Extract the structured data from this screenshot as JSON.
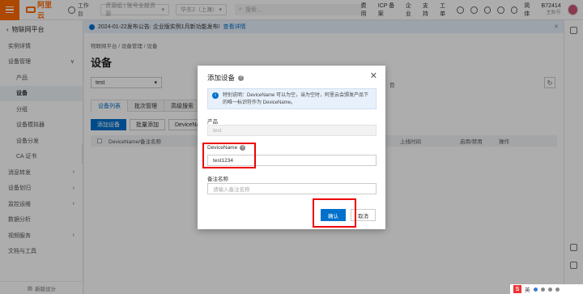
{
  "topbar": {
    "logo_text": "阿里云",
    "workbench": "工作台",
    "account_select": "资源组 | 账号全部资源",
    "region_select": "华东2（上海）",
    "search_placeholder": "搜索...",
    "links": [
      "费用",
      "ICP 备案",
      "企业",
      "支持",
      "工单"
    ],
    "lang": "简体",
    "user_id": "B72414",
    "user_sub": "主账号"
  },
  "sidebar": {
    "title": "物联网平台",
    "items": [
      {
        "label": "实例详情",
        "kind": "top"
      },
      {
        "label": "设备管理",
        "kind": "group",
        "arrow": "∨"
      },
      {
        "label": "产品",
        "kind": "sub"
      },
      {
        "label": "设备",
        "kind": "sub",
        "active": true
      },
      {
        "label": "分组",
        "kind": "sub"
      },
      {
        "label": "设备模拟器",
        "kind": "sub"
      },
      {
        "label": "设备分发",
        "kind": "sub"
      },
      {
        "label": "CA 证书",
        "kind": "sub"
      },
      {
        "label": "消息转发",
        "kind": "group",
        "arrow": "›"
      },
      {
        "label": "设备划归",
        "kind": "group",
        "arrow": "›"
      },
      {
        "label": "监控运维",
        "kind": "group",
        "arrow": "›"
      },
      {
        "label": "数据分析",
        "kind": "top"
      },
      {
        "label": "视频服务",
        "kind": "group",
        "arrow": "›"
      },
      {
        "label": "文档与工具",
        "kind": "top"
      }
    ],
    "collapse_label": "新版设计"
  },
  "notice": {
    "text": "2024-01-22发布公告: 企业版实例1月新功能发布!",
    "link": "查看详情"
  },
  "main": {
    "breadcrumb": "物联网平台 / 设备管理 / 设备",
    "title": "设备",
    "product_select": "test",
    "right_label": "目",
    "tabs": [
      "设备列表",
      "批次管理",
      "高级搜索"
    ],
    "buttons": {
      "add": "添加设备",
      "batch": "批量添加",
      "device_name": "DeviceName"
    },
    "table_headers": [
      "DeviceName/备注名称",
      "",
      "",
      "",
      "",
      "",
      "",
      "上线时间",
      "启用/禁用",
      "操作"
    ]
  },
  "dialog": {
    "title": "添加设备",
    "info": "特别说明：DeviceName 可以为空，当为空时，阿里云会颁发产品下的唯一标识符作为 DeviceName。",
    "product_label": "产品",
    "product_value": "test",
    "devicename_label": "DeviceName",
    "devicename_value": "test1234",
    "remark_label": "备注名称",
    "remark_placeholder": "请输入备注名称",
    "confirm": "确认",
    "cancel": "取消"
  },
  "tray": {
    "ime": "英"
  }
}
